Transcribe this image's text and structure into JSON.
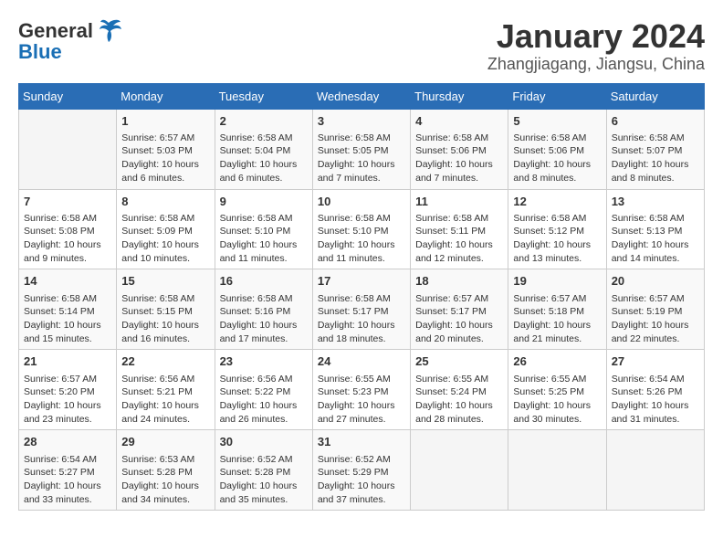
{
  "logo": {
    "text_general": "General",
    "text_blue": "Blue"
  },
  "title": "January 2024",
  "subtitle": "Zhangjiagang, Jiangsu, China",
  "days_of_week": [
    "Sunday",
    "Monday",
    "Tuesday",
    "Wednesday",
    "Thursday",
    "Friday",
    "Saturday"
  ],
  "weeks": [
    [
      {
        "day": "",
        "data": ""
      },
      {
        "day": "1",
        "data": "Sunrise: 6:57 AM\nSunset: 5:03 PM\nDaylight: 10 hours\nand 6 minutes."
      },
      {
        "day": "2",
        "data": "Sunrise: 6:58 AM\nSunset: 5:04 PM\nDaylight: 10 hours\nand 6 minutes."
      },
      {
        "day": "3",
        "data": "Sunrise: 6:58 AM\nSunset: 5:05 PM\nDaylight: 10 hours\nand 7 minutes."
      },
      {
        "day": "4",
        "data": "Sunrise: 6:58 AM\nSunset: 5:06 PM\nDaylight: 10 hours\nand 7 minutes."
      },
      {
        "day": "5",
        "data": "Sunrise: 6:58 AM\nSunset: 5:06 PM\nDaylight: 10 hours\nand 8 minutes."
      },
      {
        "day": "6",
        "data": "Sunrise: 6:58 AM\nSunset: 5:07 PM\nDaylight: 10 hours\nand 8 minutes."
      }
    ],
    [
      {
        "day": "7",
        "data": "Sunrise: 6:58 AM\nSunset: 5:08 PM\nDaylight: 10 hours\nand 9 minutes."
      },
      {
        "day": "8",
        "data": "Sunrise: 6:58 AM\nSunset: 5:09 PM\nDaylight: 10 hours\nand 10 minutes."
      },
      {
        "day": "9",
        "data": "Sunrise: 6:58 AM\nSunset: 5:10 PM\nDaylight: 10 hours\nand 11 minutes."
      },
      {
        "day": "10",
        "data": "Sunrise: 6:58 AM\nSunset: 5:10 PM\nDaylight: 10 hours\nand 11 minutes."
      },
      {
        "day": "11",
        "data": "Sunrise: 6:58 AM\nSunset: 5:11 PM\nDaylight: 10 hours\nand 12 minutes."
      },
      {
        "day": "12",
        "data": "Sunrise: 6:58 AM\nSunset: 5:12 PM\nDaylight: 10 hours\nand 13 minutes."
      },
      {
        "day": "13",
        "data": "Sunrise: 6:58 AM\nSunset: 5:13 PM\nDaylight: 10 hours\nand 14 minutes."
      }
    ],
    [
      {
        "day": "14",
        "data": "Sunrise: 6:58 AM\nSunset: 5:14 PM\nDaylight: 10 hours\nand 15 minutes."
      },
      {
        "day": "15",
        "data": "Sunrise: 6:58 AM\nSunset: 5:15 PM\nDaylight: 10 hours\nand 16 minutes."
      },
      {
        "day": "16",
        "data": "Sunrise: 6:58 AM\nSunset: 5:16 PM\nDaylight: 10 hours\nand 17 minutes."
      },
      {
        "day": "17",
        "data": "Sunrise: 6:58 AM\nSunset: 5:17 PM\nDaylight: 10 hours\nand 18 minutes."
      },
      {
        "day": "18",
        "data": "Sunrise: 6:57 AM\nSunset: 5:17 PM\nDaylight: 10 hours\nand 20 minutes."
      },
      {
        "day": "19",
        "data": "Sunrise: 6:57 AM\nSunset: 5:18 PM\nDaylight: 10 hours\nand 21 minutes."
      },
      {
        "day": "20",
        "data": "Sunrise: 6:57 AM\nSunset: 5:19 PM\nDaylight: 10 hours\nand 22 minutes."
      }
    ],
    [
      {
        "day": "21",
        "data": "Sunrise: 6:57 AM\nSunset: 5:20 PM\nDaylight: 10 hours\nand 23 minutes."
      },
      {
        "day": "22",
        "data": "Sunrise: 6:56 AM\nSunset: 5:21 PM\nDaylight: 10 hours\nand 24 minutes."
      },
      {
        "day": "23",
        "data": "Sunrise: 6:56 AM\nSunset: 5:22 PM\nDaylight: 10 hours\nand 26 minutes."
      },
      {
        "day": "24",
        "data": "Sunrise: 6:55 AM\nSunset: 5:23 PM\nDaylight: 10 hours\nand 27 minutes."
      },
      {
        "day": "25",
        "data": "Sunrise: 6:55 AM\nSunset: 5:24 PM\nDaylight: 10 hours\nand 28 minutes."
      },
      {
        "day": "26",
        "data": "Sunrise: 6:55 AM\nSunset: 5:25 PM\nDaylight: 10 hours\nand 30 minutes."
      },
      {
        "day": "27",
        "data": "Sunrise: 6:54 AM\nSunset: 5:26 PM\nDaylight: 10 hours\nand 31 minutes."
      }
    ],
    [
      {
        "day": "28",
        "data": "Sunrise: 6:54 AM\nSunset: 5:27 PM\nDaylight: 10 hours\nand 33 minutes."
      },
      {
        "day": "29",
        "data": "Sunrise: 6:53 AM\nSunset: 5:28 PM\nDaylight: 10 hours\nand 34 minutes."
      },
      {
        "day": "30",
        "data": "Sunrise: 6:52 AM\nSunset: 5:28 PM\nDaylight: 10 hours\nand 35 minutes."
      },
      {
        "day": "31",
        "data": "Sunrise: 6:52 AM\nSunset: 5:29 PM\nDaylight: 10 hours\nand 37 minutes."
      },
      {
        "day": "",
        "data": ""
      },
      {
        "day": "",
        "data": ""
      },
      {
        "day": "",
        "data": ""
      }
    ]
  ]
}
